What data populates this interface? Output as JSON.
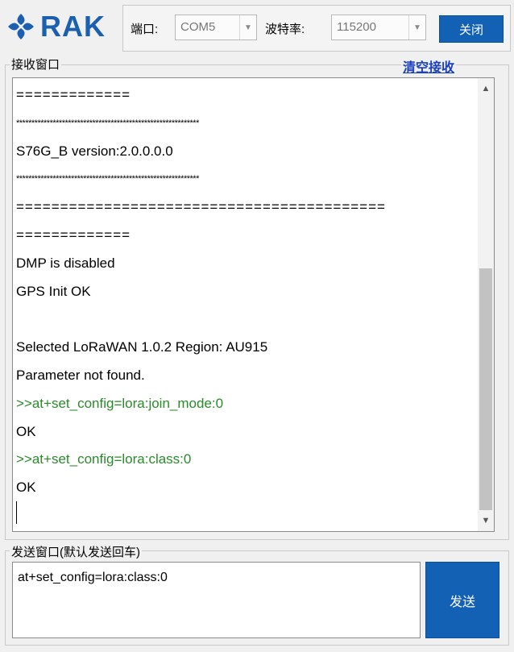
{
  "logo": {
    "text": "RAK"
  },
  "toolbar": {
    "port_label": "端口:",
    "port_value": "COM5",
    "baud_label": "波特率:",
    "baud_value": "115200",
    "close_button": "关闭"
  },
  "receive": {
    "group_title": "接收窗口",
    "clear_link": "清空接收",
    "lines": [
      {
        "text": "=============",
        "style": "eq"
      },
      {
        "text": "************************************************************",
        "style": "stars"
      },
      {
        "text": "S76G_B version:2.0.0.0.0",
        "style": "normal"
      },
      {
        "text": "************************************************************",
        "style": "stars"
      },
      {
        "text": "==========================================",
        "style": "eq"
      },
      {
        "text": "=============",
        "style": "eq"
      },
      {
        "text": "DMP is disabled",
        "style": "normal"
      },
      {
        "text": "GPS Init OK",
        "style": "normal"
      },
      {
        "text": "",
        "style": "normal"
      },
      {
        "text": "Selected LoRaWAN 1.0.2 Region: AU915",
        "style": "normal"
      },
      {
        "text": "Parameter not found.",
        "style": "normal"
      },
      {
        "text": ">>at+set_config=lora:join_mode:0",
        "style": "green"
      },
      {
        "text": "OK",
        "style": "normal"
      },
      {
        "text": ">>at+set_config=lora:class:0",
        "style": "green"
      },
      {
        "text": "OK",
        "style": "normal"
      }
    ]
  },
  "send": {
    "group_title": "发送窗口(默认发送回车)",
    "input_value": "at+set_config=lora:class:0",
    "send_button": "发送"
  },
  "colors": {
    "accent": "#1261b5",
    "link": "#1a3fc0",
    "command_text": "#2a8a2a"
  }
}
